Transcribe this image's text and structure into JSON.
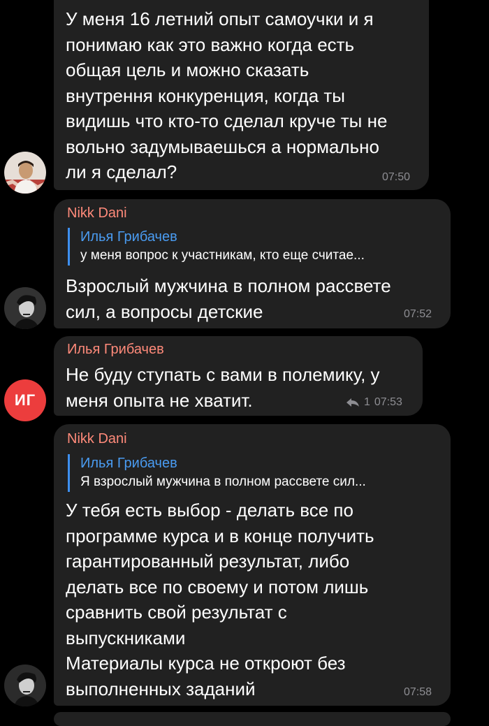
{
  "colors": {
    "background": "#000000",
    "bubble": "#212121",
    "sender": "#ff8a7a",
    "reply_name": "#4a9cf2",
    "reply_bar": "#3d8ff0",
    "timestamp": "#8e8e93",
    "initials_avatar": "#ec3d3d"
  },
  "messages": [
    {
      "lines": [
        "У меня 16 летний опыт самоучки и я",
        "понимаю как это важно когда есть",
        "общая цель и можно сказать",
        "внутрення конкуренция, когда ты",
        "видишь что кто-то сделал круче ты не",
        "вольно задумываешься а нормально",
        "ли я сделал?"
      ],
      "time": "07:50",
      "avatar_icon": "user-photo-avatar"
    },
    {
      "sender": "Nikk Dani",
      "reply": {
        "name": "Илья Грибачев",
        "text": "у меня вопрос к участникам, кто еще считае..."
      },
      "lines": [
        "Взрослый мужчина в полном рассвете",
        "сил, а вопросы детские"
      ],
      "time": "07:52",
      "avatar_icon": "user-photo-avatar"
    },
    {
      "sender": "Илья Грибачев",
      "lines": [
        "Не буду ступать с вами в полемику, у",
        "меня опыта не хватит."
      ],
      "reply_count": "1",
      "time": "07:53",
      "avatar_initials": "ИГ"
    },
    {
      "sender": "Nikk Dani",
      "reply": {
        "name": "Илья Грибачев",
        "text": "Я взрослый мужчина в полном рассвете сил..."
      },
      "lines": [
        "У тебя есть выбор - делать все по",
        "программе курса и в конце получить",
        "гарантированный результат, либо",
        "делать все по своему и потом лишь",
        "сравнить свой результат с",
        "выпускниками",
        "Материалы курса не откроют без",
        "выполненных заданий"
      ],
      "time": "07:58",
      "avatar_icon": "user-photo-avatar"
    }
  ]
}
